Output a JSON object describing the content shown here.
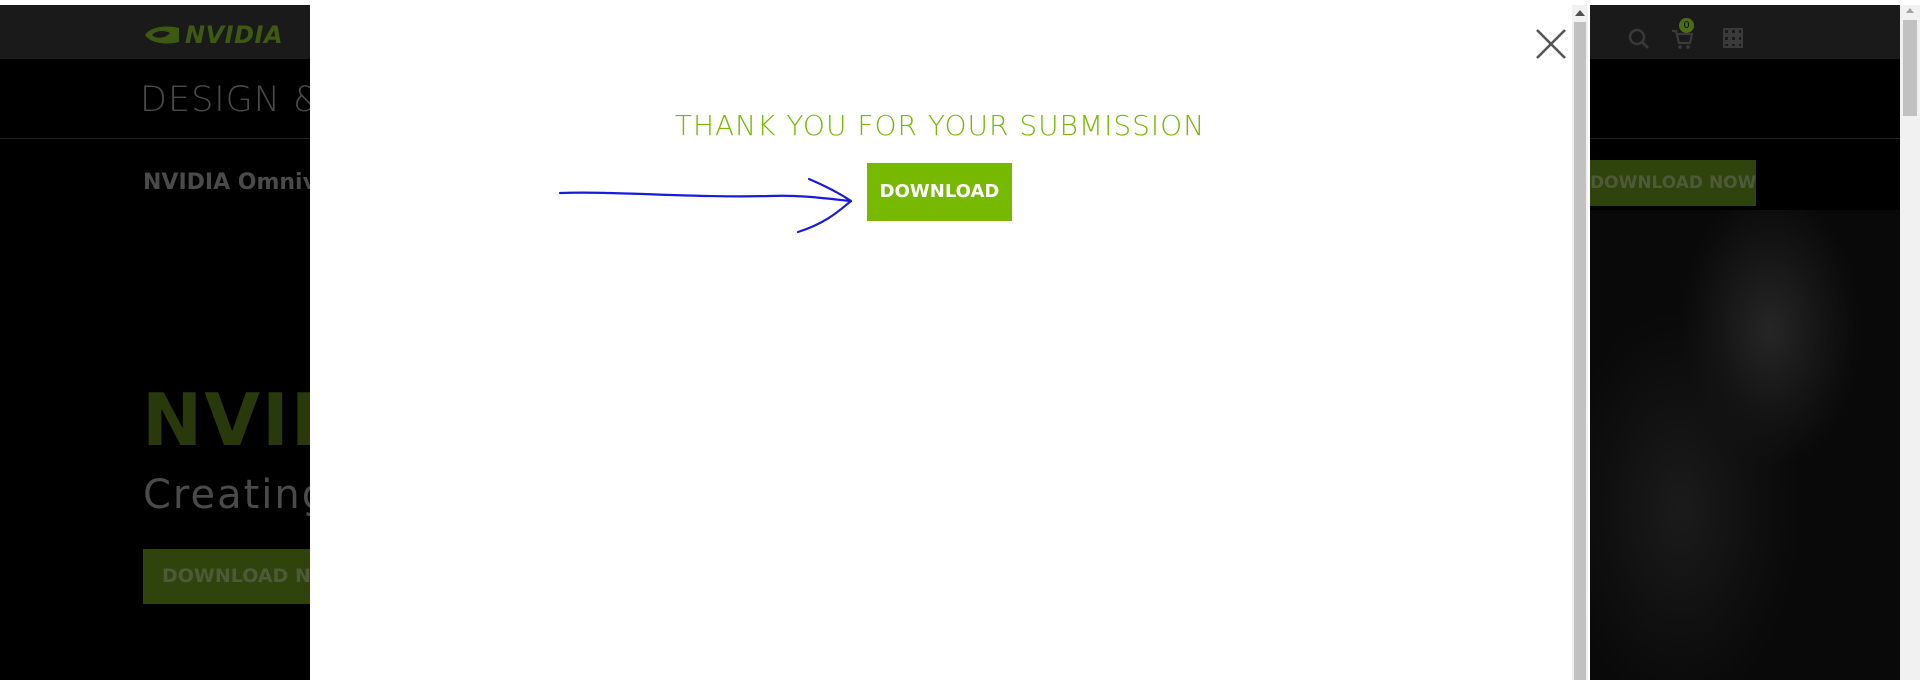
{
  "site": {
    "brand": "NVIDIA",
    "cart_count": "0",
    "subnav_title": "DESIGN & V",
    "product_name": "NVIDIA Omnive",
    "hero_title": "NVIDI",
    "hero_subtitle": "Creating a",
    "hero_download_label": "DOWNLOAD NO",
    "top_download_label": "DOWNLOAD NOW"
  },
  "modal": {
    "heading": "THANK YOU FOR YOUR SUBMISSION",
    "download_label": "DOWNLOAD"
  },
  "icons": {
    "close": "close-icon",
    "search": "search-icon",
    "cart": "cart-icon",
    "apps": "apps-grid-icon"
  },
  "colors": {
    "accent": "#76b900",
    "annotation": "#1a1adb"
  }
}
